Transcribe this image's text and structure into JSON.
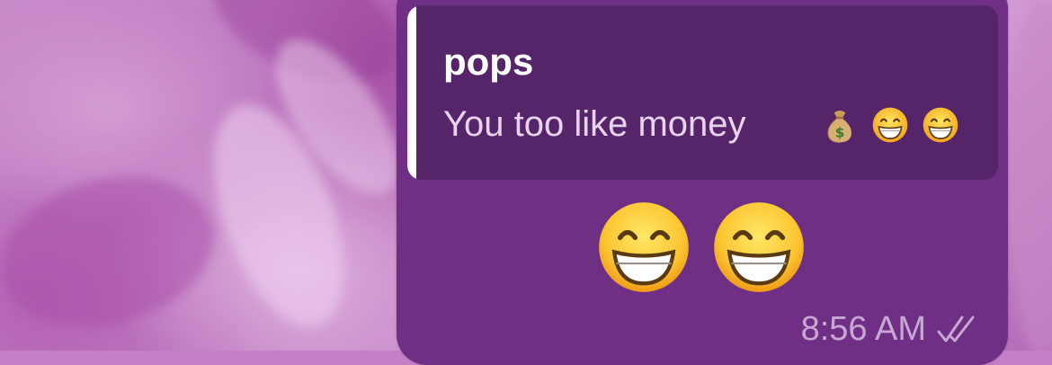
{
  "chat": {
    "reply": {
      "author": "pops",
      "text": "You too like money",
      "emojis": [
        "money-bag-icon",
        "grinning-face-icon",
        "grinning-face-icon"
      ]
    },
    "message": {
      "emojis": [
        "grinning-face-icon",
        "grinning-face-icon"
      ],
      "time": "8:56 AM",
      "status": "read"
    }
  },
  "colors": {
    "bubble": "#6f2f85",
    "quote_background": "#562468",
    "quote_bar": "#ffffff",
    "timestamp": "#c9a7d4"
  }
}
